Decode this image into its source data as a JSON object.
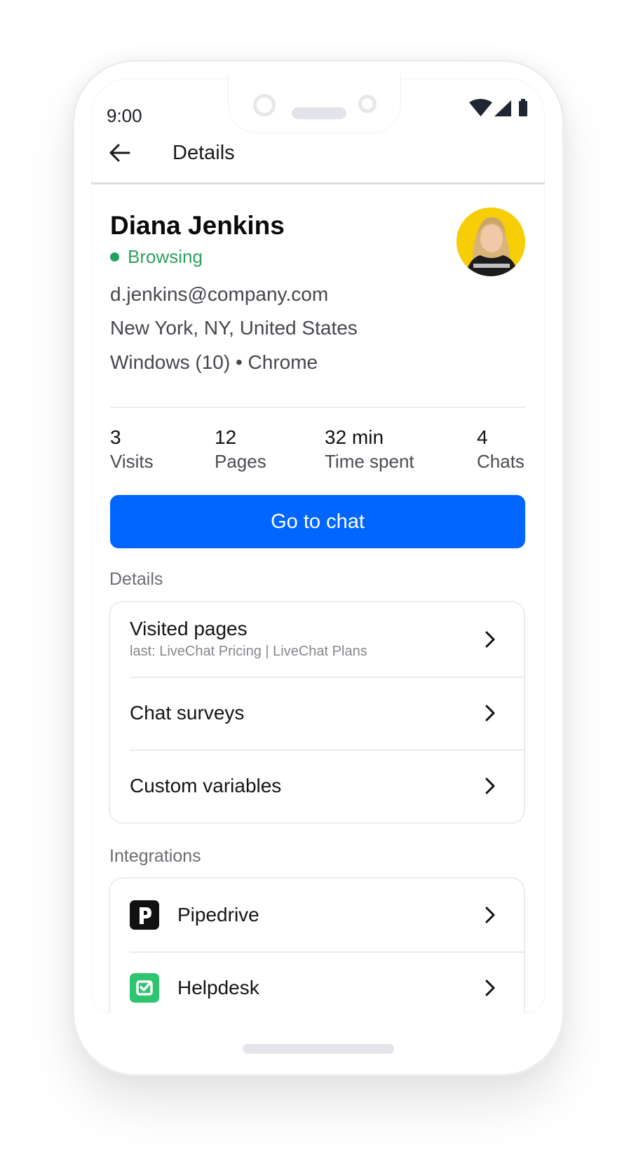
{
  "status_bar": {
    "time": "9:00",
    "icons": [
      "wifi-icon",
      "cellular-signal-icon",
      "battery-icon"
    ]
  },
  "header": {
    "back_icon": "arrow-left-icon",
    "title": "Details"
  },
  "profile": {
    "name": "Diana Jenkins",
    "status": "Browsing",
    "status_color": "#2ea160",
    "email": "d.jenkins@company.com",
    "location": "New York, NY, United States",
    "system": "Windows (10) • Chrome",
    "avatar_bg": "#f7cd05"
  },
  "stats": [
    {
      "value": "3",
      "label": "Visits"
    },
    {
      "value": "12",
      "label": "Pages"
    },
    {
      "value": "32 min",
      "label": "Time spent"
    },
    {
      "value": "4",
      "label": "Chats"
    }
  ],
  "primary_action": {
    "label": "Go to chat",
    "color": "#0066ff"
  },
  "details_section": {
    "label": "Details",
    "items": [
      {
        "title": "Visited pages",
        "subtitle": "last: LiveChat Pricing | LiveChat Plans"
      },
      {
        "title": "Chat surveys"
      },
      {
        "title": "Custom variables"
      }
    ]
  },
  "integrations_section": {
    "label": "Integrations",
    "items": [
      {
        "title": "Pipedrive",
        "icon": "pipedrive-icon",
        "icon_color": "#111111"
      },
      {
        "title": "Helpdesk",
        "icon": "helpdesk-icon",
        "icon_color": "#2fc46e"
      }
    ]
  }
}
